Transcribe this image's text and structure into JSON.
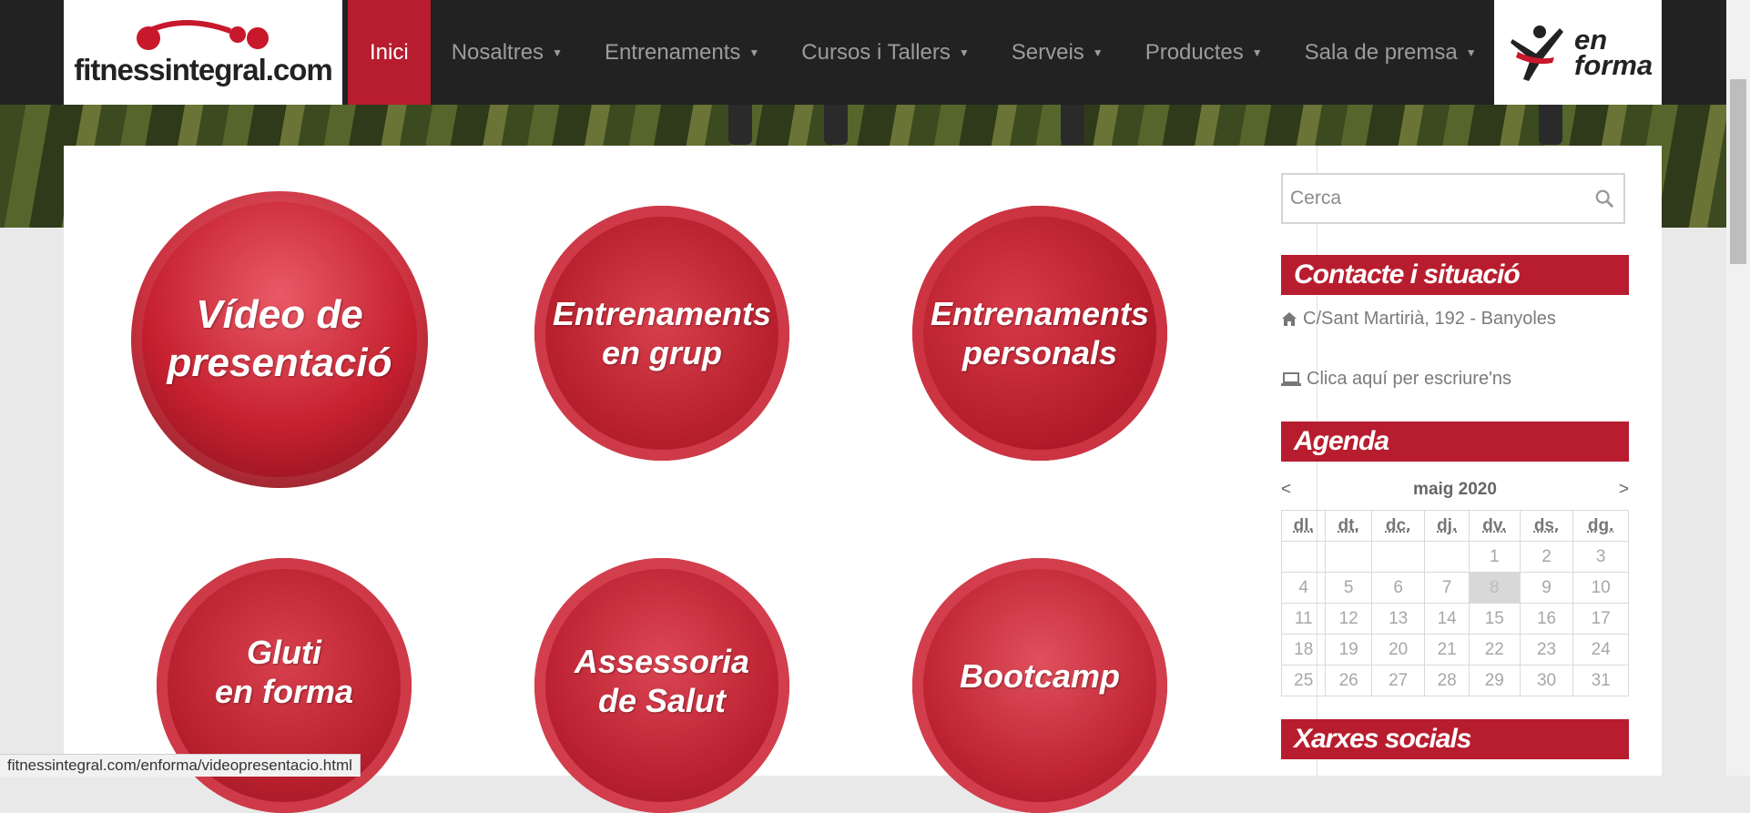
{
  "nav": {
    "logo_text": "fitnessintegral.com",
    "items": [
      {
        "label": "Inici",
        "active": true,
        "dropdown": false
      },
      {
        "label": "Nosaltres",
        "active": false,
        "dropdown": true
      },
      {
        "label": "Entrenaments",
        "active": false,
        "dropdown": true
      },
      {
        "label": "Cursos i Tallers",
        "active": false,
        "dropdown": true
      },
      {
        "label": "Serveis",
        "active": false,
        "dropdown": true
      },
      {
        "label": "Productes",
        "active": false,
        "dropdown": true
      },
      {
        "label": "Sala de premsa",
        "active": false,
        "dropdown": true
      }
    ],
    "enforma_logo_text": "en forma"
  },
  "tiles": [
    {
      "label": "Vídeo de\npresentació"
    },
    {
      "label": "Entrenaments\nen grup"
    },
    {
      "label": "Entrenaments\npersonals"
    },
    {
      "label": "Gluti\nen forma"
    },
    {
      "label": "Assessoria\nde Salut"
    },
    {
      "label": "Bootcamp"
    }
  ],
  "sidebar": {
    "search_placeholder": "Cerca",
    "contact_title": "Contacte i situació",
    "address": "C/Sant Martirià, 192 - Banyoles",
    "write_link": "Clica aquí per escriure'ns",
    "agenda_title": "Agenda",
    "calendar": {
      "prev": "<",
      "next": ">",
      "month_label": "maig  2020",
      "weekdays": [
        "dl.",
        "dt.",
        "dc.",
        "dj.",
        "dv.",
        "ds.",
        "dg."
      ],
      "weeks": [
        [
          "",
          "",
          "",
          "",
          "1",
          "2",
          "3"
        ],
        [
          "4",
          "5",
          "6",
          "7",
          "8",
          "9",
          "10"
        ],
        [
          "11",
          "12",
          "13",
          "14",
          "15",
          "16",
          "17"
        ],
        [
          "18",
          "19",
          "20",
          "21",
          "22",
          "23",
          "24"
        ],
        [
          "25",
          "26",
          "27",
          "28",
          "29",
          "30",
          "31"
        ]
      ],
      "today": "8"
    },
    "social_title": "Xarxes socials"
  },
  "status_bar_url": "fitnessintegral.com/enforma/videopresentacio.html",
  "colors": {
    "accent": "#b71d2e",
    "nav_bg": "#222222",
    "nav_text": "#9c9c9c"
  }
}
